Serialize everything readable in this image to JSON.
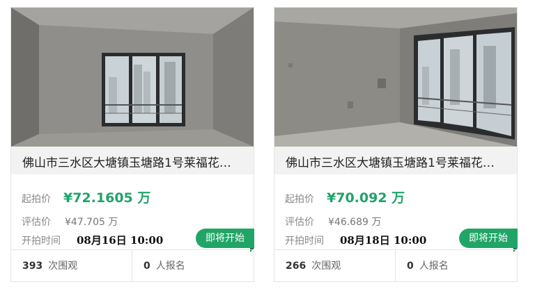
{
  "listings": [
    {
      "title": "佛山市三水区大塘镇玉塘路1号莱福花…",
      "start_price_label": "起拍价",
      "start_price": "¥72.1605 万",
      "eval_label": "评估价",
      "eval_price": "¥47.705 万",
      "time_label": "开拍时间",
      "start_time": "08月16日 10:00",
      "status": "即将开始",
      "views_count": "393",
      "views_label": "次围观",
      "signups_count": "0",
      "signups_label": "人报名"
    },
    {
      "title": "佛山市三水区大塘镇玉塘路1号莱福花…",
      "start_price_label": "起拍价",
      "start_price": "¥70.092 万",
      "eval_label": "评估价",
      "eval_price": "¥46.689 万",
      "time_label": "开拍时间",
      "start_time": "08月18日 10:00",
      "status": "即将开始",
      "views_count": "266",
      "views_label": "次围观",
      "signups_count": "0",
      "signups_label": "人报名"
    }
  ],
  "colors": {
    "accent": "#21a567",
    "price": "#1fa36a",
    "title_bg": "#f2f2f2",
    "border": "#e4e4e4"
  }
}
